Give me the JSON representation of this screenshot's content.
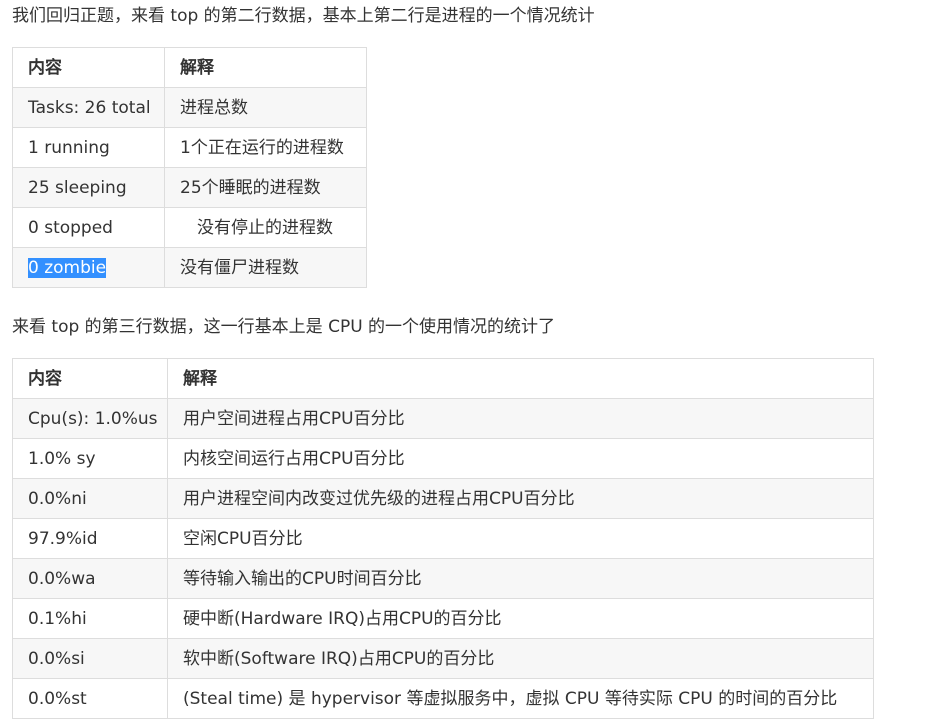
{
  "intro1": "我们回归正题，来看 top 的第二行数据，基本上第二行是进程的一个情况统计",
  "table1": {
    "headers": [
      "内容",
      "解释"
    ],
    "rows": [
      [
        "Tasks: 26 total",
        "进程总数"
      ],
      [
        "1 running",
        "1个正在运行的进程数"
      ],
      [
        "25 sleeping",
        "25个睡眠的进程数"
      ],
      [
        "0 stopped",
        "没有停止的进程数"
      ],
      [
        "0 zombie",
        "没有僵尸进程数"
      ]
    ]
  },
  "intro2": "来看 top 的第三行数据，这一行基本上是 CPU 的一个使用情况的统计了",
  "table2": {
    "headers": [
      "内容",
      "解释"
    ],
    "rows": [
      [
        "Cpu(s): 1.0%us",
        "用户空间进程占用CPU百分比"
      ],
      [
        "1.0% sy",
        "内核空间运行占用CPU百分比"
      ],
      [
        "0.0%ni",
        "用户进程空间内改变过优先级的进程占用CPU百分比"
      ],
      [
        "97.9%id",
        "空闲CPU百分比"
      ],
      [
        "0.0%wa",
        "等待输入输出的CPU时间百分比"
      ],
      [
        "0.1%hi",
        "硬中断(Hardware IRQ)占用CPU的百分比"
      ],
      [
        "0.0%si",
        "软中断(Software IRQ)占用CPU的百分比"
      ],
      [
        "0.0%st",
        "(Steal time) 是 hypervisor 等虚拟服务中，虚拟 CPU 等待实际 CPU 的时间的百分比"
      ]
    ]
  }
}
